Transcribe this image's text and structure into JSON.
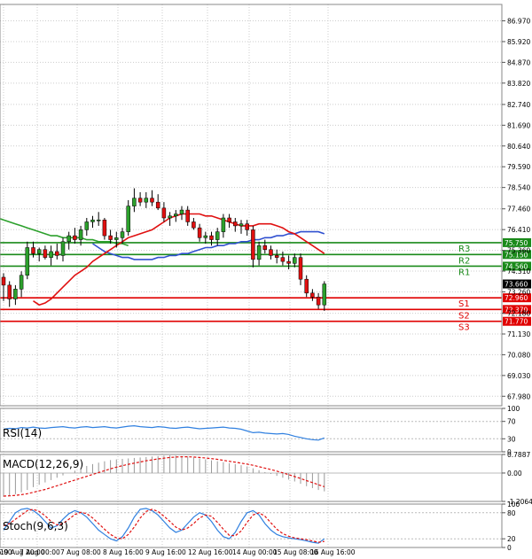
{
  "chart_data": {
    "type": "candlestick",
    "x_ticks": [
      "16:00",
      "7 Aug 00:00",
      "7 Aug 08:00",
      "8 Aug 16:00",
      "9 Aug 16:00",
      "12 Aug 16:00",
      "14 Aug 00:00",
      "15 Aug 08:00",
      "16 Aug 16:00",
      "19 Aug 20:00"
    ],
    "main": {
      "ylim": [
        67.5,
        87.8
      ],
      "y_ticks": [
        "86.970",
        "85.920",
        "84.870",
        "83.820",
        "82.740",
        "81.690",
        "80.640",
        "79.590",
        "78.540",
        "77.460",
        "76.410",
        "75.360",
        "74.310",
        "73.260",
        "72.180",
        "71.130",
        "70.080",
        "69.030",
        "67.980"
      ],
      "last_price": "73.660",
      "level_colors": {
        "resistance": "#1a8a1a",
        "support": "#e00000"
      },
      "levels": [
        {
          "name": "R3",
          "value": 75.75,
          "label": "75.750",
          "kind": "resistance"
        },
        {
          "name": "R2",
          "value": 75.15,
          "label": "75.150",
          "kind": "resistance"
        },
        {
          "name": "R1",
          "value": 74.56,
          "label": "74.560",
          "kind": "resistance"
        },
        {
          "name": "S1",
          "value": 72.96,
          "label": "72.960",
          "kind": "support"
        },
        {
          "name": "S2",
          "value": 72.37,
          "label": "72.370",
          "kind": "support"
        },
        {
          "name": "S3",
          "value": 71.77,
          "label": "71.770",
          "kind": "support"
        }
      ],
      "candles": [
        [
          74.0,
          74.2,
          72.8,
          73.6
        ],
        [
          73.6,
          73.8,
          72.5,
          72.9
        ],
        [
          72.9,
          73.6,
          72.6,
          73.4
        ],
        [
          73.4,
          74.3,
          73.0,
          74.1
        ],
        [
          74.1,
          75.8,
          73.9,
          75.5
        ],
        [
          75.5,
          75.8,
          75.0,
          75.2
        ],
        [
          75.2,
          75.5,
          74.8,
          75.4
        ],
        [
          75.4,
          75.6,
          74.9,
          75.0
        ],
        [
          75.0,
          75.6,
          74.6,
          75.3
        ],
        [
          75.3,
          75.7,
          74.9,
          75.1
        ],
        [
          75.1,
          76.0,
          74.8,
          75.8
        ],
        [
          75.8,
          76.3,
          75.4,
          76.1
        ],
        [
          76.1,
          76.5,
          75.7,
          75.9
        ],
        [
          75.9,
          76.6,
          75.6,
          76.4
        ],
        [
          76.4,
          77.0,
          76.1,
          76.8
        ],
        [
          76.8,
          77.1,
          76.5,
          76.9
        ],
        [
          76.9,
          77.3,
          76.6,
          76.9
        ],
        [
          76.9,
          77.0,
          75.9,
          76.1
        ],
        [
          76.1,
          76.4,
          75.7,
          75.9
        ],
        [
          75.9,
          76.3,
          75.5,
          76.0
        ],
        [
          76.0,
          76.5,
          75.7,
          76.3
        ],
        [
          76.3,
          77.9,
          76.1,
          77.6
        ],
        [
          77.6,
          78.5,
          77.3,
          78.0
        ],
        [
          78.0,
          78.3,
          77.6,
          77.8
        ],
        [
          77.8,
          78.3,
          77.5,
          78.0
        ],
        [
          78.0,
          78.4,
          77.6,
          77.8
        ],
        [
          77.8,
          78.2,
          77.4,
          77.5
        ],
        [
          77.5,
          77.8,
          76.8,
          77.0
        ],
        [
          77.0,
          77.3,
          76.6,
          77.1
        ],
        [
          77.1,
          77.4,
          76.8,
          77.2
        ],
        [
          77.2,
          77.6,
          76.9,
          77.4
        ],
        [
          77.4,
          77.6,
          76.6,
          76.8
        ],
        [
          76.8,
          77.0,
          76.4,
          76.5
        ],
        [
          76.5,
          76.7,
          75.8,
          76.0
        ],
        [
          76.0,
          76.3,
          75.7,
          76.1
        ],
        [
          76.1,
          76.3,
          75.6,
          75.9
        ],
        [
          75.9,
          76.5,
          75.6,
          76.3
        ],
        [
          76.3,
          77.2,
          76.0,
          77.0
        ],
        [
          77.0,
          77.2,
          76.5,
          76.8
        ],
        [
          76.8,
          77.0,
          76.3,
          76.6
        ],
        [
          76.6,
          76.9,
          76.2,
          76.7
        ],
        [
          76.7,
          76.9,
          76.1,
          76.4
        ],
        [
          76.4,
          76.6,
          74.5,
          74.9
        ],
        [
          74.9,
          75.8,
          74.6,
          75.6
        ],
        [
          75.6,
          75.9,
          75.2,
          75.4
        ],
        [
          75.4,
          75.6,
          74.9,
          75.1
        ],
        [
          75.1,
          75.4,
          74.7,
          75.0
        ],
        [
          75.0,
          75.3,
          74.6,
          74.8
        ],
        [
          74.8,
          75.1,
          74.4,
          74.7
        ],
        [
          74.7,
          75.2,
          74.5,
          75.0
        ],
        [
          75.0,
          75.2,
          73.6,
          73.9
        ],
        [
          73.9,
          74.1,
          73.0,
          73.2
        ],
        [
          73.2,
          73.4,
          72.8,
          73.0
        ],
        [
          73.0,
          73.2,
          72.4,
          72.6
        ],
        [
          72.6,
          73.8,
          72.3,
          73.66
        ]
      ],
      "ma_red": [
        72.8,
        72.6,
        72.7,
        72.9,
        73.2,
        73.5,
        73.8,
        74.1,
        74.3,
        74.5,
        74.8,
        75.0,
        75.2,
        75.4,
        75.6,
        75.8,
        76.0,
        76.1,
        76.2,
        76.3,
        76.4,
        76.6,
        76.8,
        77.0,
        77.1,
        77.2,
        77.2,
        77.2,
        77.2,
        77.1,
        77.1,
        77.0,
        76.9,
        76.8,
        76.7,
        76.6,
        76.6,
        76.6,
        76.7,
        76.7,
        76.7,
        76.6,
        76.5,
        76.3,
        76.2,
        76.0,
        75.8,
        75.6,
        75.4,
        75.2
      ],
      "ma_blue": [
        75.7,
        75.5,
        75.3,
        75.2,
        75.1,
        75.0,
        75.0,
        74.9,
        74.9,
        74.9,
        74.9,
        75.0,
        75.0,
        75.1,
        75.1,
        75.2,
        75.2,
        75.3,
        75.4,
        75.5,
        75.5,
        75.6,
        75.6,
        75.7,
        75.7,
        75.8,
        75.8,
        75.9,
        75.9,
        76.0,
        76.0,
        76.1,
        76.1,
        76.2,
        76.2,
        76.3,
        76.3,
        76.3,
        76.3,
        76.2
      ],
      "ma_green": [
        77.6,
        77.5,
        77.3,
        77.2,
        77.0,
        76.9,
        76.8,
        76.7,
        76.6,
        76.5,
        76.4,
        76.3,
        76.2,
        76.1,
        76.1,
        76.0,
        76.0,
        76.0,
        76.0,
        75.9,
        75.9,
        75.8,
        75.8,
        75.8,
        75.7,
        75.7,
        75.6
      ]
    },
    "rsi": {
      "label": "RSI(14)",
      "y_ticks": [
        "100",
        "70",
        "30",
        "0"
      ],
      "ylim": [
        0,
        100
      ],
      "levels": [
        70,
        30
      ],
      "values": [
        52,
        54,
        53,
        56,
        55,
        57,
        55,
        54,
        56,
        57,
        58,
        56,
        55,
        57,
        58,
        56,
        57,
        58,
        56,
        55,
        57,
        59,
        60,
        58,
        57,
        56,
        58,
        57,
        55,
        54,
        56,
        57,
        55,
        53,
        54,
        55,
        56,
        57,
        55,
        54,
        52,
        48,
        44,
        45,
        43,
        42,
        41,
        42,
        40,
        36,
        33,
        30,
        28,
        27,
        32
      ]
    },
    "macd": {
      "label": "MACD(12,26,9)",
      "y_ticks": [
        "0.7887",
        "0.00",
        "-1.2064"
      ],
      "ylim": [
        -1.2064,
        0.7887
      ],
      "histogram": [
        -1.0,
        -0.95,
        -0.9,
        -0.82,
        -0.72,
        -0.6,
        -0.5,
        -0.4,
        -0.3,
        -0.2,
        -0.1,
        0.0,
        0.1,
        0.2,
        0.3,
        0.38,
        0.44,
        0.5,
        0.55,
        0.58,
        0.6,
        0.62,
        0.64,
        0.66,
        0.68,
        0.7,
        0.72,
        0.74,
        0.75,
        0.74,
        0.72,
        0.7,
        0.66,
        0.62,
        0.58,
        0.54,
        0.5,
        0.46,
        0.42,
        0.38,
        0.33,
        0.28,
        0.2,
        0.12,
        0.04,
        -0.04,
        -0.12,
        -0.2,
        -0.28,
        -0.36,
        -0.46,
        -0.56,
        -0.64,
        -0.72,
        -0.78
      ],
      "signal": [
        -0.98,
        -0.97,
        -0.95,
        -0.92,
        -0.88,
        -0.82,
        -0.76,
        -0.7,
        -0.62,
        -0.54,
        -0.46,
        -0.38,
        -0.3,
        -0.22,
        -0.14,
        -0.06,
        0.02,
        0.1,
        0.18,
        0.25,
        0.31,
        0.37,
        0.42,
        0.47,
        0.52,
        0.56,
        0.6,
        0.63,
        0.66,
        0.68,
        0.69,
        0.69,
        0.68,
        0.66,
        0.64,
        0.61,
        0.58,
        0.54,
        0.5,
        0.46,
        0.42,
        0.38,
        0.33,
        0.27,
        0.21,
        0.15,
        0.08,
        0.01,
        -0.07,
        -0.15,
        -0.23,
        -0.32,
        -0.41,
        -0.5,
        -0.58
      ]
    },
    "stoch": {
      "label": "Stoch(9,6,3)",
      "y_ticks": [
        "100",
        "80",
        "20",
        "0"
      ],
      "ylim": [
        0,
        100
      ],
      "levels": [
        80,
        20
      ],
      "k": [
        40,
        60,
        80,
        88,
        90,
        85,
        75,
        60,
        45,
        50,
        65,
        78,
        85,
        80,
        70,
        55,
        40,
        30,
        20,
        15,
        25,
        45,
        70,
        88,
        90,
        85,
        75,
        60,
        45,
        35,
        40,
        55,
        70,
        80,
        75,
        60,
        40,
        25,
        20,
        35,
        60,
        80,
        85,
        75,
        55,
        40,
        30,
        25,
        22,
        20,
        18,
        15,
        12,
        10,
        20
      ],
      "d": [
        50,
        55,
        65,
        75,
        85,
        88,
        83,
        73,
        60,
        52,
        55,
        65,
        76,
        81,
        78,
        68,
        55,
        42,
        30,
        22,
        20,
        30,
        47,
        68,
        83,
        88,
        83,
        72,
        60,
        47,
        40,
        45,
        55,
        68,
        75,
        72,
        58,
        42,
        28,
        27,
        38,
        58,
        75,
        80,
        72,
        57,
        42,
        32,
        26,
        22,
        20,
        18,
        15,
        12,
        14
      ]
    }
  }
}
